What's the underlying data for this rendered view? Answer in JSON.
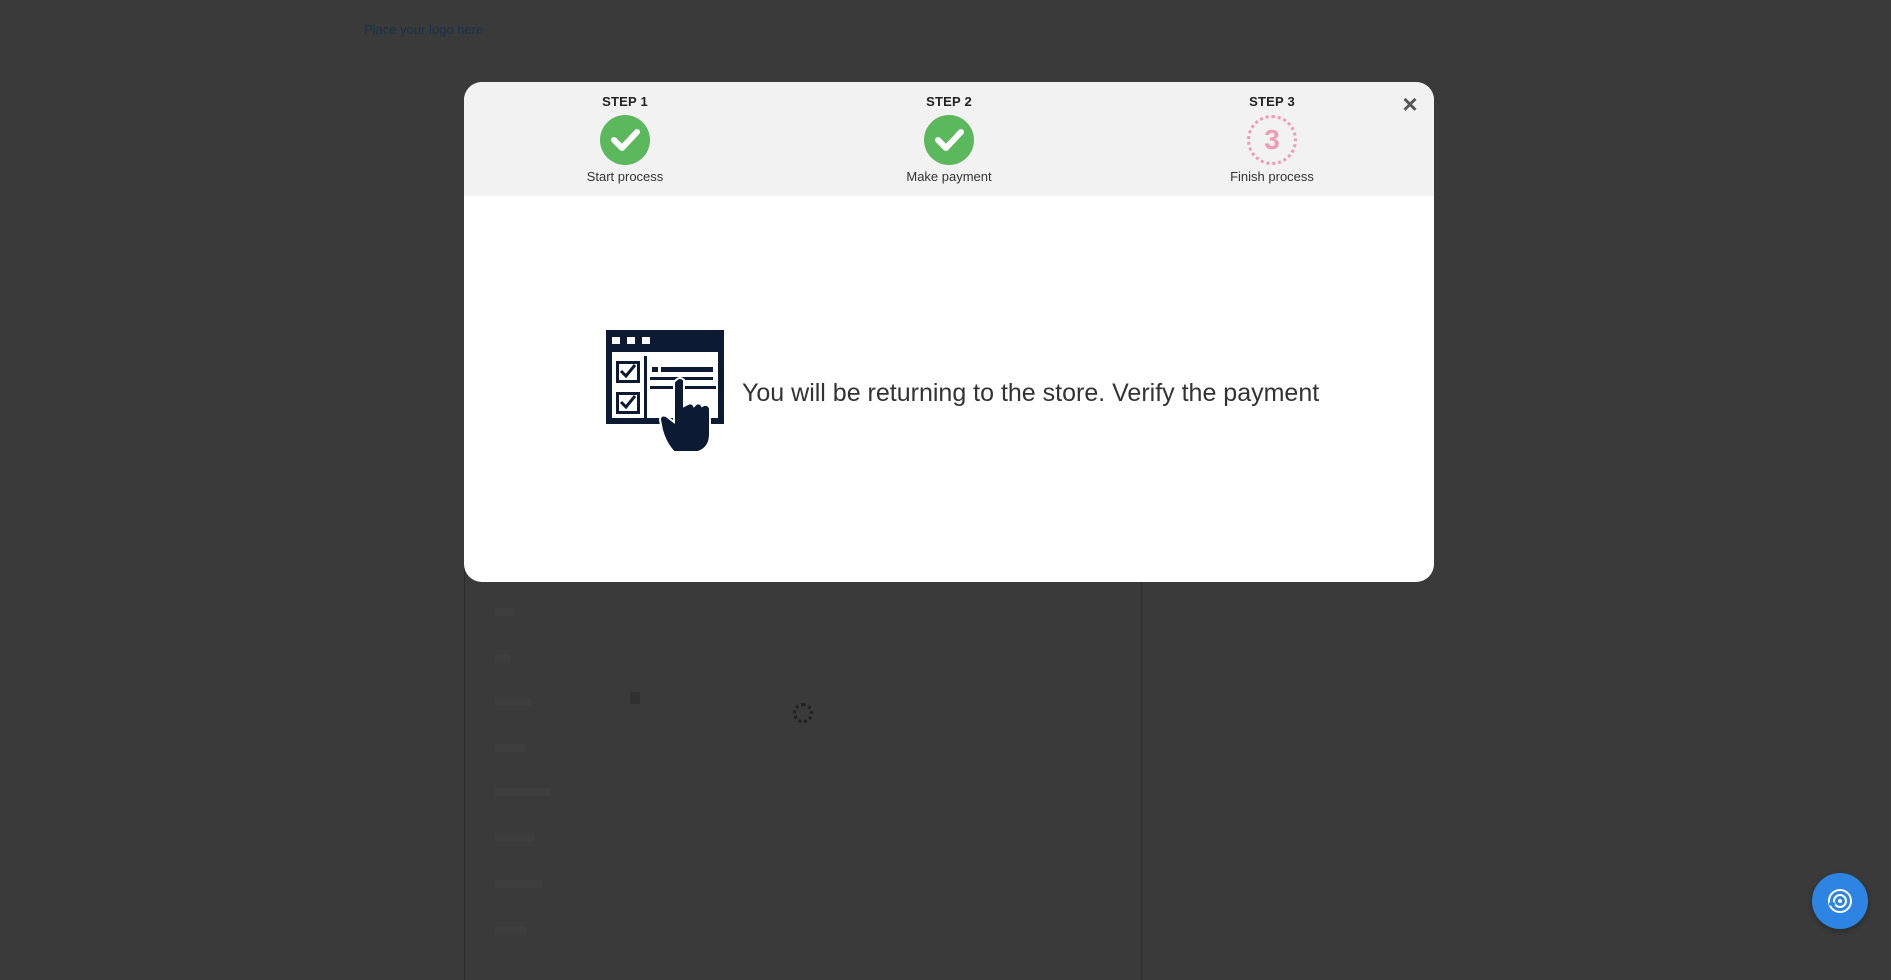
{
  "background": {
    "logo_text": "Place your logo here"
  },
  "modal": {
    "close_label": "×",
    "steps": [
      {
        "title": "STEP 1",
        "label": "Start process",
        "status": "completed"
      },
      {
        "title": "STEP 2",
        "label": "Make payment",
        "status": "completed"
      },
      {
        "title": "STEP 3",
        "label": "Finish process",
        "status": "pending",
        "number": "3"
      }
    ],
    "message": "You will be returning to the store. Verify the payment",
    "message_icon": "checklist-click-icon"
  },
  "fab": {
    "icon": "chat-support-icon"
  },
  "colors": {
    "completed": "#5cb85c",
    "pending": "#f19bb5",
    "fab": "#2d84e2",
    "overlay": "#3a3a3a"
  }
}
